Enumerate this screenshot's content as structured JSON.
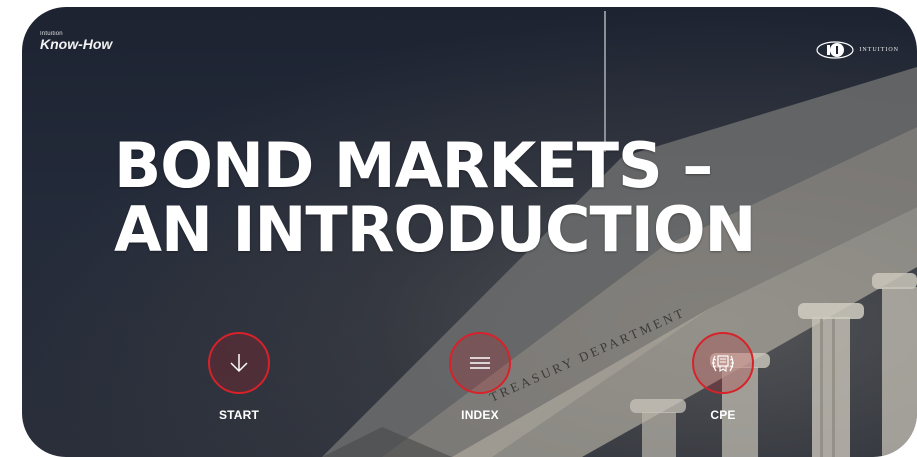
{
  "brand": {
    "small": "Intuition",
    "name": "Know-How"
  },
  "logo": {
    "text": "INTUITION"
  },
  "hero": {
    "line1": "BOND MARKETS –",
    "line2": "AN INTRODUCTION"
  },
  "nav": [
    {
      "label": "START",
      "icon": "arrow-down-icon"
    },
    {
      "label": "INDEX",
      "icon": "menu-lines-icon"
    },
    {
      "label": "CPE",
      "icon": "certificate-laurel-icon"
    }
  ],
  "background": {
    "inscription": "TREASURY DEPARTMENT"
  },
  "colors": {
    "accent": "#d7222a",
    "background": "#1d2331",
    "text": "#ffffff"
  }
}
